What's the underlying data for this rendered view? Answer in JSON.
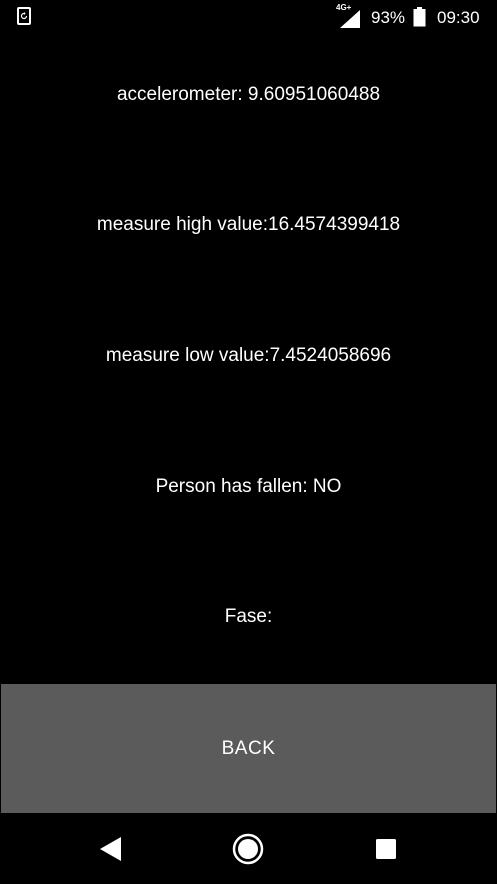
{
  "status_bar": {
    "network_type": "4G+",
    "battery_percent": "93%",
    "time": "09:30",
    "icons": [
      "app-notification-icon",
      "signal-icon",
      "battery-icon"
    ]
  },
  "readings": {
    "accelerometer": "accelerometer: 9.60951060488",
    "measure_high": "measure high value:16.4574399418",
    "measure_low": "measure low value:7.4524058696",
    "person_fallen": "Person has fallen: NO",
    "fase": "Fase:"
  },
  "back_button": {
    "label": "BACK"
  },
  "nav_bar": {
    "icons": [
      "back-triangle-icon",
      "home-circle-icon",
      "recents-square-icon"
    ]
  },
  "colors": {
    "background": "#000000",
    "text": "#ffffff",
    "button_bg": "#5b5b5b"
  }
}
